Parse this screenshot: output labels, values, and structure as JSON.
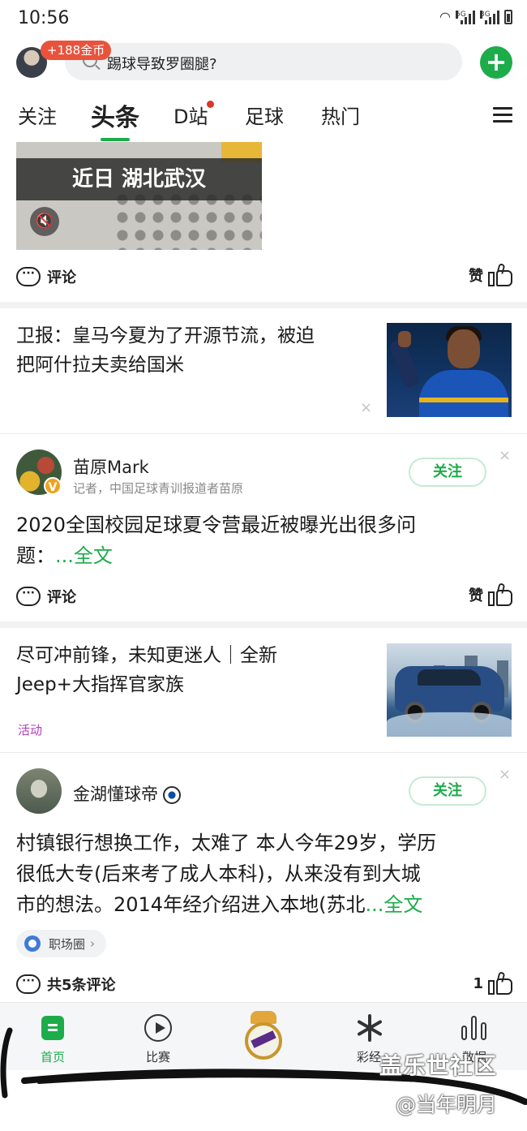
{
  "status_bar": {
    "time": "10:56",
    "net1": "5G",
    "net2": "3G"
  },
  "header": {
    "coin_badge": "+188金币",
    "search_placeholder": "踢球导致罗圈腿?"
  },
  "tabs": [
    {
      "label": "关注",
      "active": false
    },
    {
      "label": "头条",
      "active": true
    },
    {
      "label": "D站",
      "active": false,
      "dot": true
    },
    {
      "label": "足球",
      "active": false
    },
    {
      "label": "热门",
      "active": false
    }
  ],
  "video_card": {
    "caption": "近日 湖北武汉",
    "comment_label": "评论",
    "like_label": "赞"
  },
  "news_1": {
    "title_line1": "卫报：皇马今夏为了开源节流，被迫",
    "title_line2": "把阿什拉夫卖给国米",
    "close": "×"
  },
  "post_1": {
    "author": "苗原Mark",
    "verified_badge": "V",
    "desc": "记者，中国足球青训报道者苗原",
    "follow_label": "关注",
    "text_line1": "2020全国校园足球夏令营最近被曝光出很多问",
    "text_line2": "题：",
    "more_link": "...全文",
    "comment_label": "评论",
    "like_label": "赞",
    "close": "×"
  },
  "ad_1": {
    "title_line1": "尽可冲前锋，未知更迷人｜全新",
    "title_line2": "Jeep+大指挥官家族",
    "tag": "活动"
  },
  "post_2": {
    "author": "金湖懂球帝",
    "follow_label": "关注",
    "text_line1": "村镇银行想换工作，太难了 本人今年29岁，学历",
    "text_line2": "很低大专(后来考了成人本科)，从来没有到大城",
    "text_line3": "市的想法。2014年经介绍进入本地(苏北",
    "more_link": "...全文",
    "topic": "职场圈",
    "topic_chevron": "›",
    "comment_label": "共5条评论",
    "like_count": "1",
    "close": "×"
  },
  "bottom_nav": [
    {
      "label": "首页",
      "active": true,
      "icon": "home-icon"
    },
    {
      "label": "比赛",
      "active": false,
      "icon": "play-icon"
    },
    {
      "label": "",
      "active": false,
      "icon": "club-crest-icon"
    },
    {
      "label": "彩经",
      "active": false,
      "icon": "lottery-icon"
    },
    {
      "label": "数据",
      "active": false,
      "icon": "stats-icon"
    }
  ],
  "watermark": {
    "line1": "盖乐世社区",
    "line2": "@当年明月"
  },
  "colors": {
    "accent": "#1dac4a",
    "badge": "#e9533c",
    "ad_tag": "#b23ebd"
  }
}
